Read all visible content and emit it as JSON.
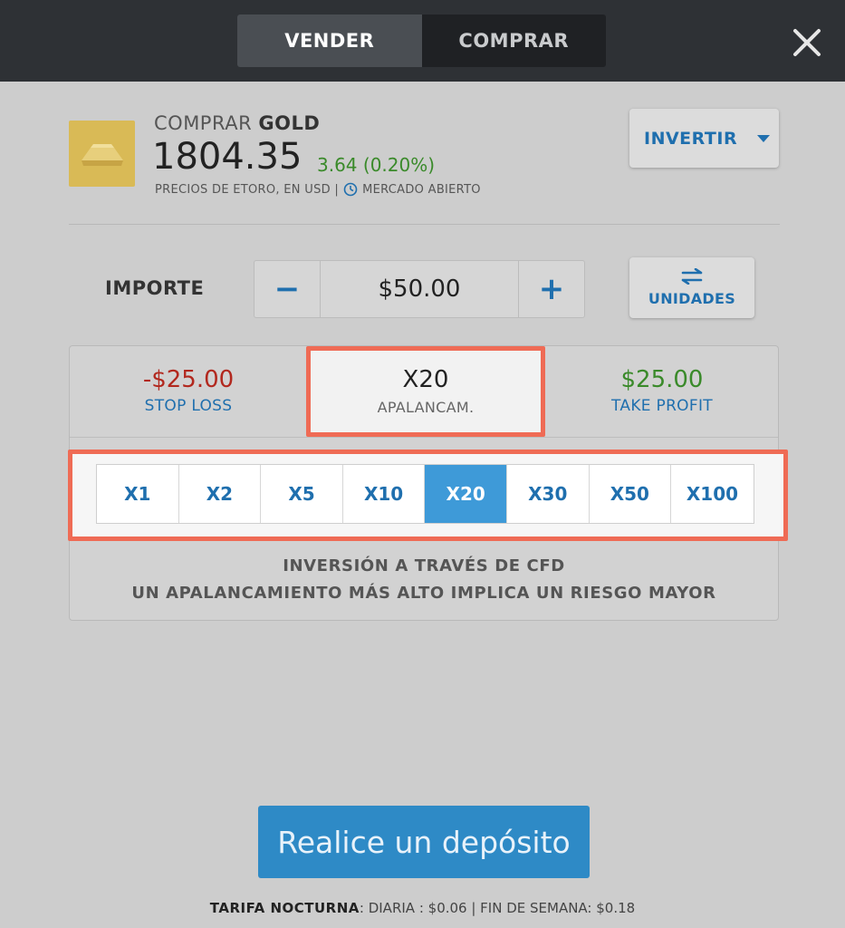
{
  "toggle": {
    "sell_label": "VENDER",
    "buy_label": "COMPRAR"
  },
  "asset": {
    "action": "COMPRAR",
    "symbol": "GOLD",
    "price": "1804.35",
    "change": "3.64 (0.20%)",
    "source_text": "PRECIOS DE ETORO, EN USD |",
    "market_status": "MERCADO ABIERTO",
    "icon": "gold-bar-icon"
  },
  "invest_button": {
    "label": "INVERTIR",
    "icon": "caret-down-icon"
  },
  "amount": {
    "label": "IMPORTE",
    "minus": "−",
    "value": "$50.00",
    "plus": "+",
    "units_label": "UNIDADES",
    "units_icon": "swap-arrows-icon"
  },
  "risk": {
    "stop_loss_value": "-$25.00",
    "stop_loss_label": "STOP LOSS",
    "leverage_value": "X20",
    "leverage_label": "APALANCAM.",
    "take_profit_value": "$25.00",
    "take_profit_label": "TAKE PROFIT"
  },
  "leverage_options": [
    "X1",
    "X2",
    "X5",
    "X10",
    "X20",
    "X30",
    "X50",
    "X100"
  ],
  "leverage_selected": "X20",
  "cfd_note": {
    "line1": "INVERSIÓN A TRAVÉS DE CFD",
    "line2": "UN APALANCAMIENTO MÁS ALTO IMPLICA UN RIESGO MAYOR"
  },
  "deposit_button": {
    "label": "Realice un depósito"
  },
  "fees": {
    "title": "TARIFA NOCTURNA",
    "text": ": DIARIA : $0.06 | FIN DE SEMANA: $0.18"
  },
  "colors": {
    "accent": "#1f6fae",
    "selected": "#3e9ad8",
    "loss": "#b2281e",
    "gain": "#3a8a2a",
    "highlight": "#ef6b55"
  }
}
